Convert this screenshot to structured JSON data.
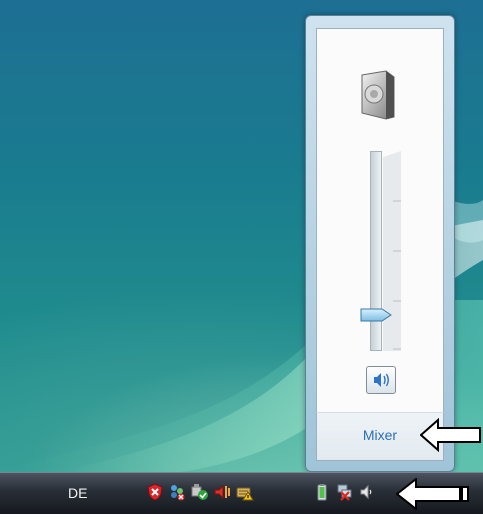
{
  "taskbar": {
    "language": "DE",
    "tray_icons": [
      "shield-error-icon",
      "network-error-icon",
      "update-ok-icon",
      "volume-icon",
      "keyboard-warning-icon",
      "battery-icon",
      "network-disconnected-icon",
      "volume-tray-icon"
    ]
  },
  "volume_flyout": {
    "device_icon": "speaker-icon",
    "mute_button_icon": "speaker-volume-icon",
    "mixer_label": "Mixer",
    "slider_level": 0.17
  },
  "colors": {
    "accent_link": "#2a6fb7",
    "flyout_frame": "#a9cbe0",
    "taskbar": "#1b1f25"
  },
  "annotations": {
    "arrow_icons": [
      "left-arrow-icon",
      "left-arrow-icon"
    ]
  }
}
